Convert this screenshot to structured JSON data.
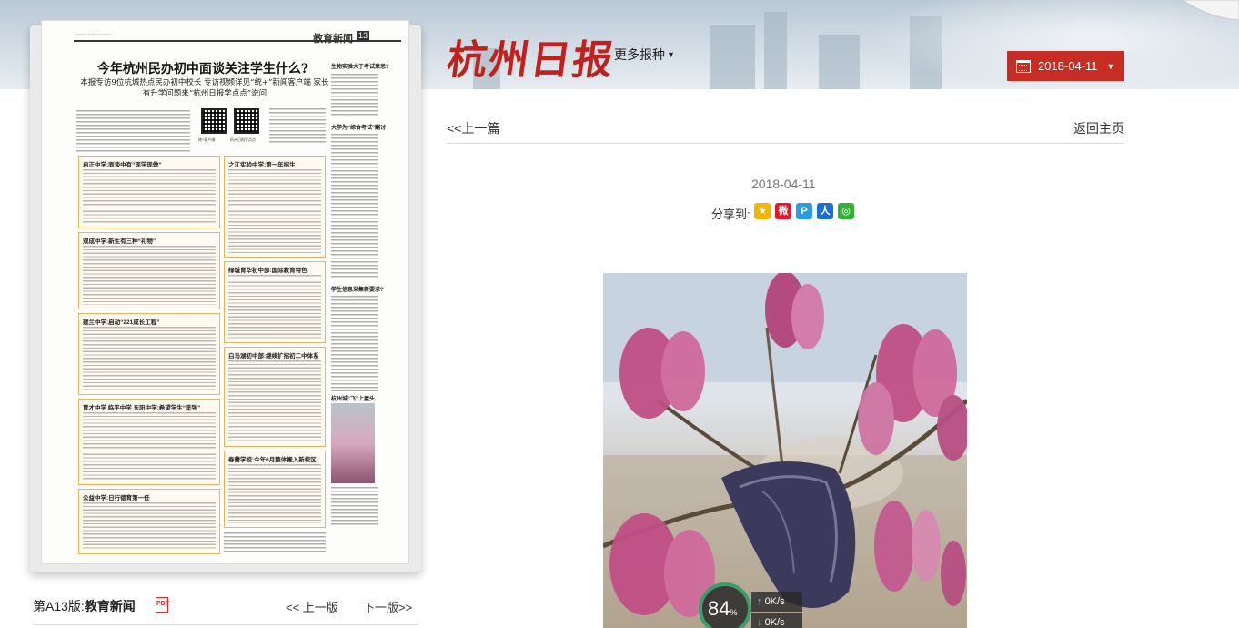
{
  "header": {
    "logo": "杭州日报",
    "more_papers": "更多报种",
    "date": "2018-04-11"
  },
  "newspaper": {
    "section_name": "教育新闻",
    "page_num": "13",
    "headline": "今年杭州民办初中面谈关注学生什么?",
    "subheadline": "本报专访9位杭城热点民办初中校长 专访视频详见“统+”新闻客户端 家长有升学问题来“杭州日报学点点”说问",
    "box_titles": [
      "启正中学:面谈中有“现学现做”",
      "之江实验中学:第一年招生",
      "观成中学:新生有三种“礼物”",
      "建兰中学:启动“221成长工程”",
      "绿城育华初中部:国际教育特色",
      "白马湖初中部:继续扩招初二中体系",
      "育才中学 临平中学 东阳中学:希望学生“坚强”",
      "公益中学:日行德育第一任",
      "春蕾学校:今年6月整体搬入新校区"
    ],
    "right_col_titles": [
      "生物实验大于考试意思?",
      "大学为“综合考试”翻讨",
      "学生信息采集新要求?",
      "杭州城“飞”上屋头"
    ],
    "qr_labels": [
      "统+客户端",
      "杭州日报学点点"
    ],
    "footer_page_label": "第A13版:",
    "footer_page_name": "教育新闻",
    "pdf_icon": "pdf-icon",
    "prev_page": "<< 上一版",
    "next_page": "下一版>>"
  },
  "article": {
    "prev_link": "<<上一篇",
    "home_link": "返回主页",
    "date": "2018-04-11",
    "share_label": "分享到:",
    "share_icons": [
      "qzone-icon",
      "weibo-icon",
      "tencent-weibo-icon",
      "renren-icon",
      "wechat-icon"
    ]
  },
  "net_widget": {
    "percent": "84",
    "percent_unit": "%",
    "up_speed": "0K/s",
    "down_speed": "0K/s"
  },
  "colors": {
    "brand_red": "#c62d25",
    "logo_red": "#c0211d"
  }
}
